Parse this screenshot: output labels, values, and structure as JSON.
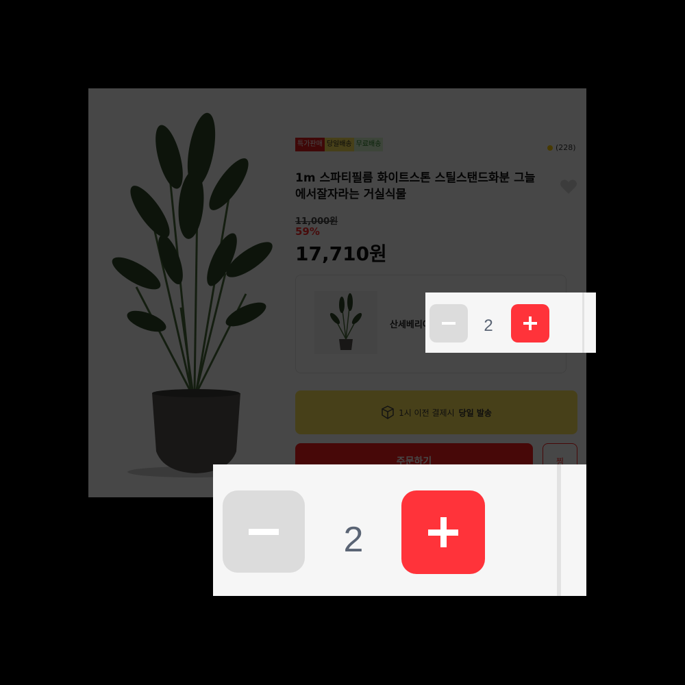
{
  "badges": [
    "특가판매",
    "당일배송",
    "무료배송"
  ],
  "rating": {
    "count": "(228)"
  },
  "product": {
    "title": "1m 스파티필름 화이트스톤 스틸스탠드화분 그늘에서잘자라는 거실식물",
    "original_price": "11,000원",
    "discount": "59%",
    "price": "17,710원"
  },
  "option": {
    "label": "산세베리아"
  },
  "delivery": {
    "prefix": "1시 이전 결제시",
    "highlight": "당일 발송"
  },
  "actions": {
    "order": "주문하기",
    "wish": "찜"
  },
  "quantity": {
    "value": "2"
  },
  "colors": {
    "accent": "#ff333a",
    "banner": "#ffe45c",
    "minus_bg": "#dcdcdc"
  },
  "icons": [
    "heart-icon",
    "box-icon",
    "minus-icon",
    "plus-icon",
    "star-icon"
  ]
}
